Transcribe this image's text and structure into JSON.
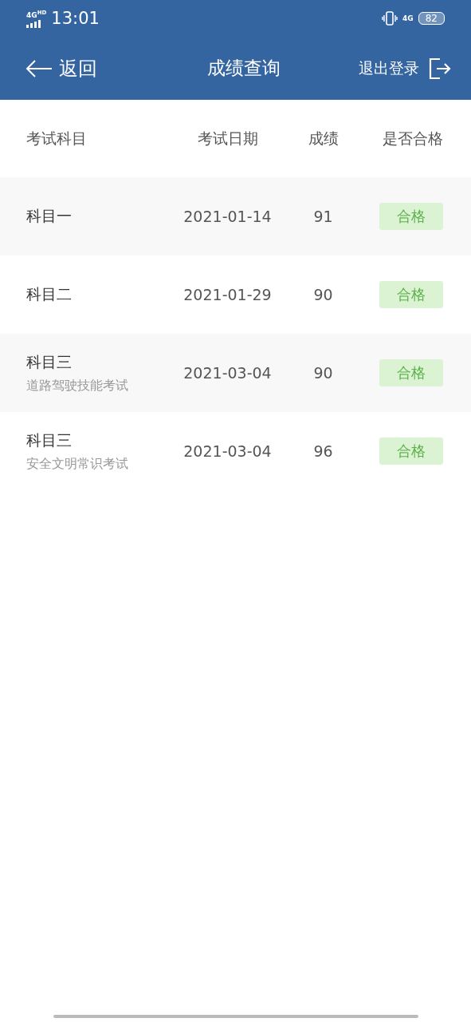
{
  "status_bar": {
    "network": "4G",
    "network_badge": "HD",
    "time": "13:01",
    "data_type": "4G",
    "battery": "82"
  },
  "nav_bar": {
    "back": "返回",
    "title": "成绩查询",
    "logout": "退出登录"
  },
  "table": {
    "columns": [
      "考试科目",
      "考试日期",
      "成绩",
      "是否合格"
    ],
    "rows": [
      {
        "subject": "科目一",
        "date": "2021-01-14",
        "score": "91",
        "result": "合格",
        "passed": true
      },
      {
        "subject": "科目二",
        "date": "2021-01-29",
        "score": "90",
        "result": "合格",
        "passed": true
      },
      {
        "subject": "科目三",
        "detail": "道路驾驶技能考试",
        "date": "2021-03-04",
        "score": "90",
        "result": "合格",
        "passed": true
      },
      {
        "subject": "科目三",
        "detail": "安全文明常识考试",
        "date": "2021-03-04",
        "score": "96",
        "result": "合格",
        "passed": true
      }
    ]
  }
}
